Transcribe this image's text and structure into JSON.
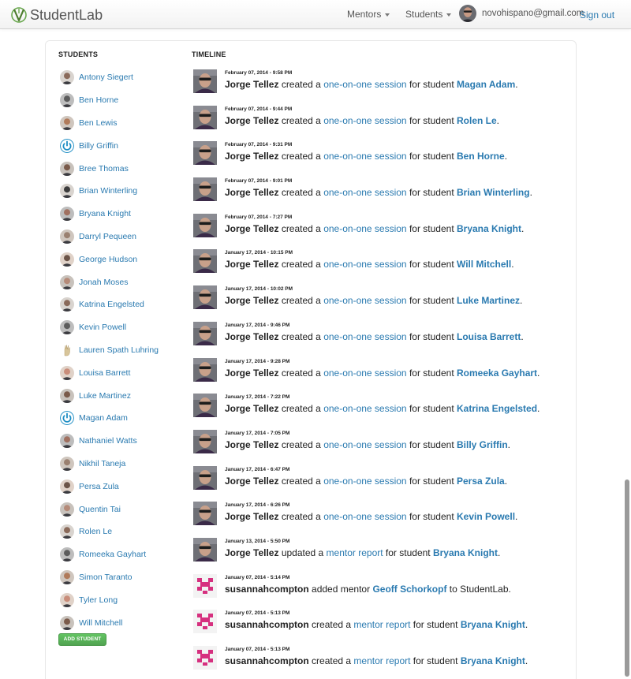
{
  "navbar": {
    "brand": "StudentLab",
    "mentors_label": "Mentors",
    "students_label": "Students",
    "user_email": "novohispano@gmail.com",
    "signout_label": "Sign out"
  },
  "students_section": {
    "title": "STUDENTS",
    "add_button_label": "ADD STUDENT",
    "students": [
      {
        "name": "Antony Siegert",
        "avatar": "photo"
      },
      {
        "name": "Ben Horne",
        "avatar": "photo"
      },
      {
        "name": "Ben Lewis",
        "avatar": "photo"
      },
      {
        "name": "Billy Griffin",
        "avatar": "power-icon"
      },
      {
        "name": "Bree Thomas",
        "avatar": "photo"
      },
      {
        "name": "Brian Winterling",
        "avatar": "photo"
      },
      {
        "name": "Bryana Knight",
        "avatar": "photo"
      },
      {
        "name": "Darryl Pequeen",
        "avatar": "photo"
      },
      {
        "name": "George Hudson",
        "avatar": "photo"
      },
      {
        "name": "Jonah Moses",
        "avatar": "photo"
      },
      {
        "name": "Katrina Engelsted",
        "avatar": "photo"
      },
      {
        "name": "Kevin Powell",
        "avatar": "photo"
      },
      {
        "name": "Lauren Spath Luhring",
        "avatar": "hand-icon"
      },
      {
        "name": "Louisa Barrett",
        "avatar": "photo"
      },
      {
        "name": "Luke Martinez",
        "avatar": "photo"
      },
      {
        "name": "Magan Adam",
        "avatar": "power-icon"
      },
      {
        "name": "Nathaniel Watts",
        "avatar": "photo"
      },
      {
        "name": "Nikhil Taneja",
        "avatar": "photo"
      },
      {
        "name": "Persa Zula",
        "avatar": "photo"
      },
      {
        "name": "Quentin Tai",
        "avatar": "photo"
      },
      {
        "name": "Rolen Le",
        "avatar": "photo"
      },
      {
        "name": "Romeeka Gayhart",
        "avatar": "photo"
      },
      {
        "name": "Simon Taranto",
        "avatar": "photo"
      },
      {
        "name": "Tyler Long",
        "avatar": "photo"
      },
      {
        "name": "Will Mitchell",
        "avatar": "photo"
      }
    ]
  },
  "timeline_section": {
    "title": "TIMELINE",
    "events": [
      {
        "date": "February 07, 2014 - 9:58 PM",
        "actor": "Jorge Tellez",
        "avatar": "jorge",
        "verb": "created a",
        "object": "one-on-one session",
        "middle": "for student",
        "target": "Magan Adam",
        "end": "."
      },
      {
        "date": "February 07, 2014 - 9:44 PM",
        "actor": "Jorge Tellez",
        "avatar": "jorge",
        "verb": "created a",
        "object": "one-on-one session",
        "middle": "for student",
        "target": "Rolen Le",
        "end": "."
      },
      {
        "date": "February 07, 2014 - 9:31 PM",
        "actor": "Jorge Tellez",
        "avatar": "jorge",
        "verb": "created a",
        "object": "one-on-one session",
        "middle": "for student",
        "target": "Ben Horne",
        "end": "."
      },
      {
        "date": "February 07, 2014 - 9:01 PM",
        "actor": "Jorge Tellez",
        "avatar": "jorge",
        "verb": "created a",
        "object": "one-on-one session",
        "middle": "for student",
        "target": "Brian Winterling",
        "end": "."
      },
      {
        "date": "February 07, 2014 - 7:27 PM",
        "actor": "Jorge Tellez",
        "avatar": "jorge",
        "verb": "created a",
        "object": "one-on-one session",
        "middle": "for student",
        "target": "Bryana Knight",
        "end": "."
      },
      {
        "date": "January 17, 2014 - 10:15 PM",
        "actor": "Jorge Tellez",
        "avatar": "jorge",
        "verb": "created a",
        "object": "one-on-one session",
        "middle": "for student",
        "target": "Will Mitchell",
        "end": "."
      },
      {
        "date": "January 17, 2014 - 10:02 PM",
        "actor": "Jorge Tellez",
        "avatar": "jorge",
        "verb": "created a",
        "object": "one-on-one session",
        "middle": "for student",
        "target": "Luke Martinez",
        "end": "."
      },
      {
        "date": "January 17, 2014 - 9:46 PM",
        "actor": "Jorge Tellez",
        "avatar": "jorge",
        "verb": "created a",
        "object": "one-on-one session",
        "middle": "for student",
        "target": "Louisa Barrett",
        "end": "."
      },
      {
        "date": "January 17, 2014 - 9:28 PM",
        "actor": "Jorge Tellez",
        "avatar": "jorge",
        "verb": "created a",
        "object": "one-on-one session",
        "middle": "for student",
        "target": "Romeeka Gayhart",
        "end": "."
      },
      {
        "date": "January 17, 2014 - 7:22 PM",
        "actor": "Jorge Tellez",
        "avatar": "jorge",
        "verb": "created a",
        "object": "one-on-one session",
        "middle": "for student",
        "target": "Katrina Engelsted",
        "end": "."
      },
      {
        "date": "January 17, 2014 - 7:05 PM",
        "actor": "Jorge Tellez",
        "avatar": "jorge",
        "verb": "created a",
        "object": "one-on-one session",
        "middle": "for student",
        "target": "Billy Griffin",
        "end": "."
      },
      {
        "date": "January 17, 2014 - 6:47 PM",
        "actor": "Jorge Tellez",
        "avatar": "jorge",
        "verb": "created a",
        "object": "one-on-one session",
        "middle": "for student",
        "target": "Persa Zula",
        "end": "."
      },
      {
        "date": "January 17, 2014 - 6:26 PM",
        "actor": "Jorge Tellez",
        "avatar": "jorge",
        "verb": "created a",
        "object": "one-on-one session",
        "middle": "for student",
        "target": "Kevin Powell",
        "end": "."
      },
      {
        "date": "January 13, 2014 - 5:50 PM",
        "actor": "Jorge Tellez",
        "avatar": "jorge",
        "verb": "updated a",
        "object": "mentor report",
        "middle": "for student",
        "target": "Bryana Knight",
        "end": "."
      },
      {
        "date": "January 07, 2014 - 5:14 PM",
        "actor": "susannahcompton",
        "avatar": "identicon",
        "verb": "added mentor",
        "object": "",
        "middle": "",
        "target": "Geoff Schorkopf",
        "end": " to StudentLab."
      },
      {
        "date": "January 07, 2014 - 5:13 PM",
        "actor": "susannahcompton",
        "avatar": "identicon",
        "verb": "created a",
        "object": "mentor report",
        "middle": "for student",
        "target": "Bryana Knight",
        "end": "."
      },
      {
        "date": "January 07, 2014 - 5:13 PM",
        "actor": "susannahcompton",
        "avatar": "identicon",
        "verb": "created a",
        "object": "mentor report",
        "middle": "for student",
        "target": "Bryana Knight",
        "end": "."
      }
    ]
  },
  "colors": {
    "link": "#2a7ab0",
    "add_button": "#5bb75b",
    "identicon": "#d6307f"
  }
}
